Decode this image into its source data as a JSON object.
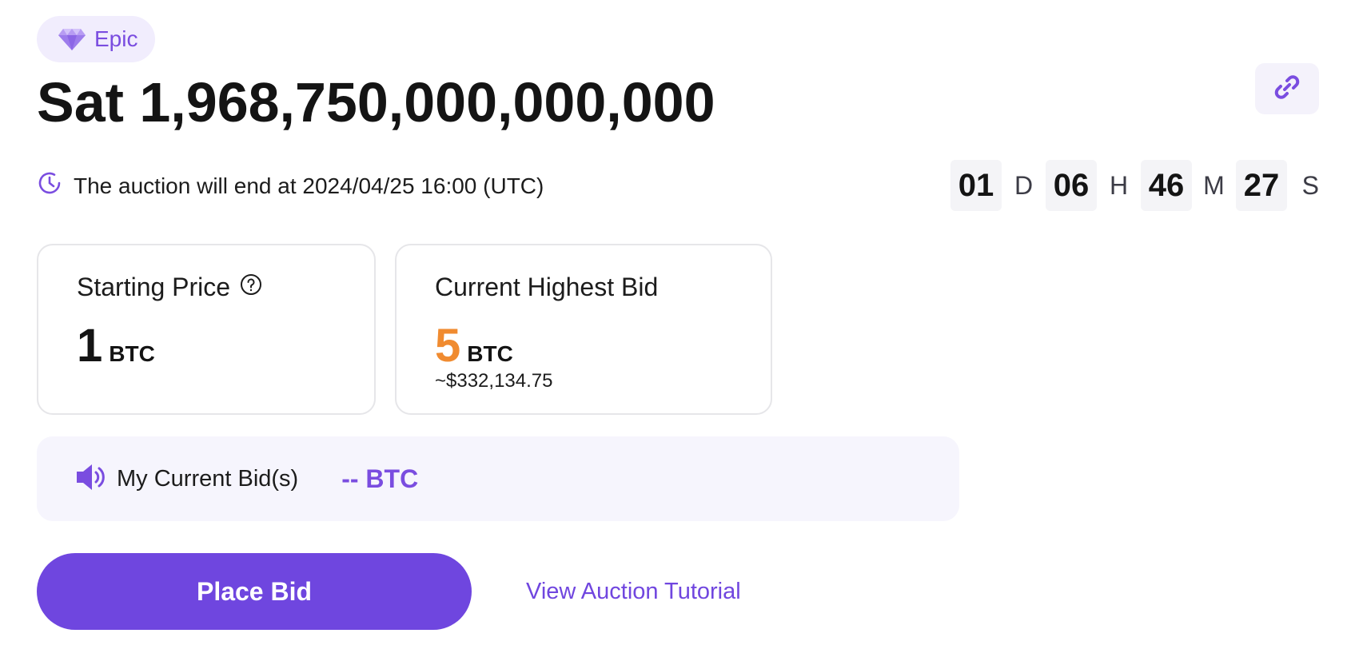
{
  "badge": {
    "icon": "diamond-icon",
    "label": "Epic",
    "color": "#7a4de0"
  },
  "title": "Sat 1,968,750,000,000,000",
  "share": {
    "icon": "link-icon"
  },
  "auction": {
    "icon": "clock-icon",
    "end_text": "The auction will end at 2024/04/25 16:00 (UTC)"
  },
  "countdown": {
    "days": "01",
    "days_unit": "D",
    "hours": "06",
    "hours_unit": "H",
    "minutes": "46",
    "minutes_unit": "M",
    "seconds": "27",
    "seconds_unit": "S"
  },
  "starting_price": {
    "label": "Starting Price",
    "help_icon": "question-circle-icon",
    "value": "1",
    "unit": "BTC"
  },
  "highest_bid": {
    "label": "Current Highest Bid",
    "value": "5",
    "unit": "BTC",
    "usd": "~$332,134.75",
    "color": "#f08b30"
  },
  "my_bid": {
    "icon": "speaker-icon",
    "label": "My Current Bid(s)",
    "value": "-- BTC"
  },
  "actions": {
    "place_bid": "Place Bid",
    "tutorial": "View Auction Tutorial"
  },
  "colors": {
    "accent": "#6f46df"
  }
}
